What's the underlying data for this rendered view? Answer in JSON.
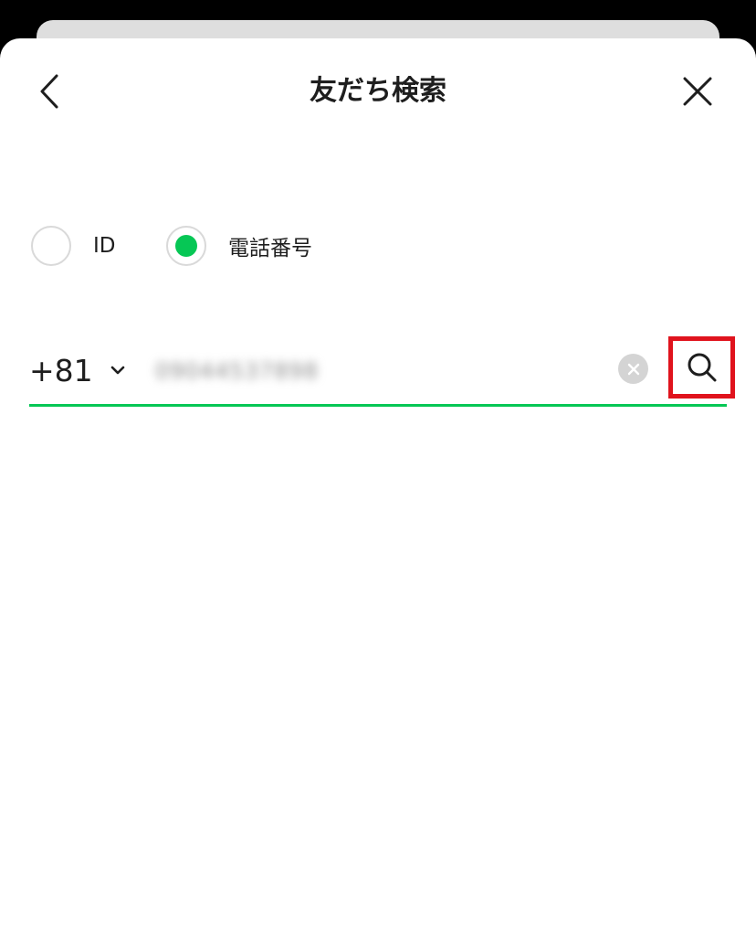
{
  "header": {
    "title": "友だち検索"
  },
  "search_type": {
    "options": [
      {
        "label": "ID",
        "selected": false
      },
      {
        "label": "電話番号",
        "selected": true
      }
    ]
  },
  "phone": {
    "country_code": "+81",
    "number_value": "09044537898"
  },
  "colors": {
    "accent": "#06c755",
    "highlight": "#e0131d"
  },
  "icons": {
    "back": "chevron-left-icon",
    "close": "close-icon",
    "dropdown": "chevron-down-icon",
    "clear": "clear-icon",
    "search": "search-icon"
  }
}
